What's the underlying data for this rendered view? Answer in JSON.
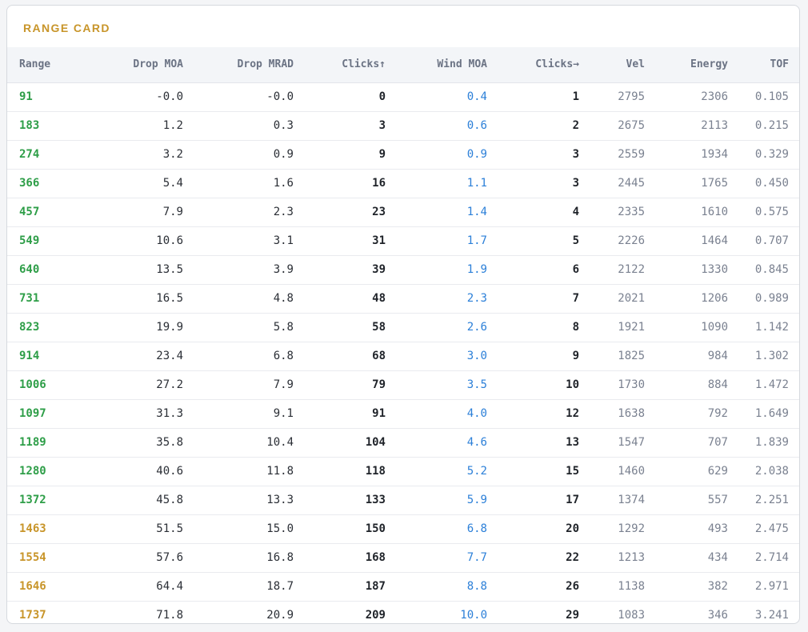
{
  "card": {
    "title": "RANGE CARD"
  },
  "columns": [
    "Range",
    "Drop MOA",
    "Drop MRAD",
    "Clicks↑",
    "Wind MOA",
    "Clicks→",
    "Vel",
    "Energy",
    "TOF"
  ],
  "colors": {
    "title": "#c8952a",
    "range_ok": "#2e9e48",
    "range_warn": "#c8952a",
    "wind": "#2b7fd8"
  },
  "rows": [
    {
      "range": "91",
      "drop_moa": "-0.0",
      "drop_mrad": "-0.0",
      "clicks_up": "0",
      "wind_moa": "0.4",
      "clicks_right": "1",
      "vel": "2795",
      "energy": "2306",
      "tof": "0.105",
      "status": "ok"
    },
    {
      "range": "183",
      "drop_moa": "1.2",
      "drop_mrad": "0.3",
      "clicks_up": "3",
      "wind_moa": "0.6",
      "clicks_right": "2",
      "vel": "2675",
      "energy": "2113",
      "tof": "0.215",
      "status": "ok"
    },
    {
      "range": "274",
      "drop_moa": "3.2",
      "drop_mrad": "0.9",
      "clicks_up": "9",
      "wind_moa": "0.9",
      "clicks_right": "3",
      "vel": "2559",
      "energy": "1934",
      "tof": "0.329",
      "status": "ok"
    },
    {
      "range": "366",
      "drop_moa": "5.4",
      "drop_mrad": "1.6",
      "clicks_up": "16",
      "wind_moa": "1.1",
      "clicks_right": "3",
      "vel": "2445",
      "energy": "1765",
      "tof": "0.450",
      "status": "ok"
    },
    {
      "range": "457",
      "drop_moa": "7.9",
      "drop_mrad": "2.3",
      "clicks_up": "23",
      "wind_moa": "1.4",
      "clicks_right": "4",
      "vel": "2335",
      "energy": "1610",
      "tof": "0.575",
      "status": "ok"
    },
    {
      "range": "549",
      "drop_moa": "10.6",
      "drop_mrad": "3.1",
      "clicks_up": "31",
      "wind_moa": "1.7",
      "clicks_right": "5",
      "vel": "2226",
      "energy": "1464",
      "tof": "0.707",
      "status": "ok"
    },
    {
      "range": "640",
      "drop_moa": "13.5",
      "drop_mrad": "3.9",
      "clicks_up": "39",
      "wind_moa": "1.9",
      "clicks_right": "6",
      "vel": "2122",
      "energy": "1330",
      "tof": "0.845",
      "status": "ok"
    },
    {
      "range": "731",
      "drop_moa": "16.5",
      "drop_mrad": "4.8",
      "clicks_up": "48",
      "wind_moa": "2.3",
      "clicks_right": "7",
      "vel": "2021",
      "energy": "1206",
      "tof": "0.989",
      "status": "ok"
    },
    {
      "range": "823",
      "drop_moa": "19.9",
      "drop_mrad": "5.8",
      "clicks_up": "58",
      "wind_moa": "2.6",
      "clicks_right": "8",
      "vel": "1921",
      "energy": "1090",
      "tof": "1.142",
      "status": "ok"
    },
    {
      "range": "914",
      "drop_moa": "23.4",
      "drop_mrad": "6.8",
      "clicks_up": "68",
      "wind_moa": "3.0",
      "clicks_right": "9",
      "vel": "1825",
      "energy": "984",
      "tof": "1.302",
      "status": "ok"
    },
    {
      "range": "1006",
      "drop_moa": "27.2",
      "drop_mrad": "7.9",
      "clicks_up": "79",
      "wind_moa": "3.5",
      "clicks_right": "10",
      "vel": "1730",
      "energy": "884",
      "tof": "1.472",
      "status": "ok"
    },
    {
      "range": "1097",
      "drop_moa": "31.3",
      "drop_mrad": "9.1",
      "clicks_up": "91",
      "wind_moa": "4.0",
      "clicks_right": "12",
      "vel": "1638",
      "energy": "792",
      "tof": "1.649",
      "status": "ok"
    },
    {
      "range": "1189",
      "drop_moa": "35.8",
      "drop_mrad": "10.4",
      "clicks_up": "104",
      "wind_moa": "4.6",
      "clicks_right": "13",
      "vel": "1547",
      "energy": "707",
      "tof": "1.839",
      "status": "ok"
    },
    {
      "range": "1280",
      "drop_moa": "40.6",
      "drop_mrad": "11.8",
      "clicks_up": "118",
      "wind_moa": "5.2",
      "clicks_right": "15",
      "vel": "1460",
      "energy": "629",
      "tof": "2.038",
      "status": "ok"
    },
    {
      "range": "1372",
      "drop_moa": "45.8",
      "drop_mrad": "13.3",
      "clicks_up": "133",
      "wind_moa": "5.9",
      "clicks_right": "17",
      "vel": "1374",
      "energy": "557",
      "tof": "2.251",
      "status": "ok"
    },
    {
      "range": "1463",
      "drop_moa": "51.5",
      "drop_mrad": "15.0",
      "clicks_up": "150",
      "wind_moa": "6.8",
      "clicks_right": "20",
      "vel": "1292",
      "energy": "493",
      "tof": "2.475",
      "status": "warn"
    },
    {
      "range": "1554",
      "drop_moa": "57.6",
      "drop_mrad": "16.8",
      "clicks_up": "168",
      "wind_moa": "7.7",
      "clicks_right": "22",
      "vel": "1213",
      "energy": "434",
      "tof": "2.714",
      "status": "warn"
    },
    {
      "range": "1646",
      "drop_moa": "64.4",
      "drop_mrad": "18.7",
      "clicks_up": "187",
      "wind_moa": "8.8",
      "clicks_right": "26",
      "vel": "1138",
      "energy": "382",
      "tof": "2.971",
      "status": "warn"
    },
    {
      "range": "1737",
      "drop_moa": "71.8",
      "drop_mrad": "20.9",
      "clicks_up": "209",
      "wind_moa": "10.0",
      "clicks_right": "29",
      "vel": "1083",
      "energy": "346",
      "tof": "3.241",
      "status": "warn"
    }
  ]
}
